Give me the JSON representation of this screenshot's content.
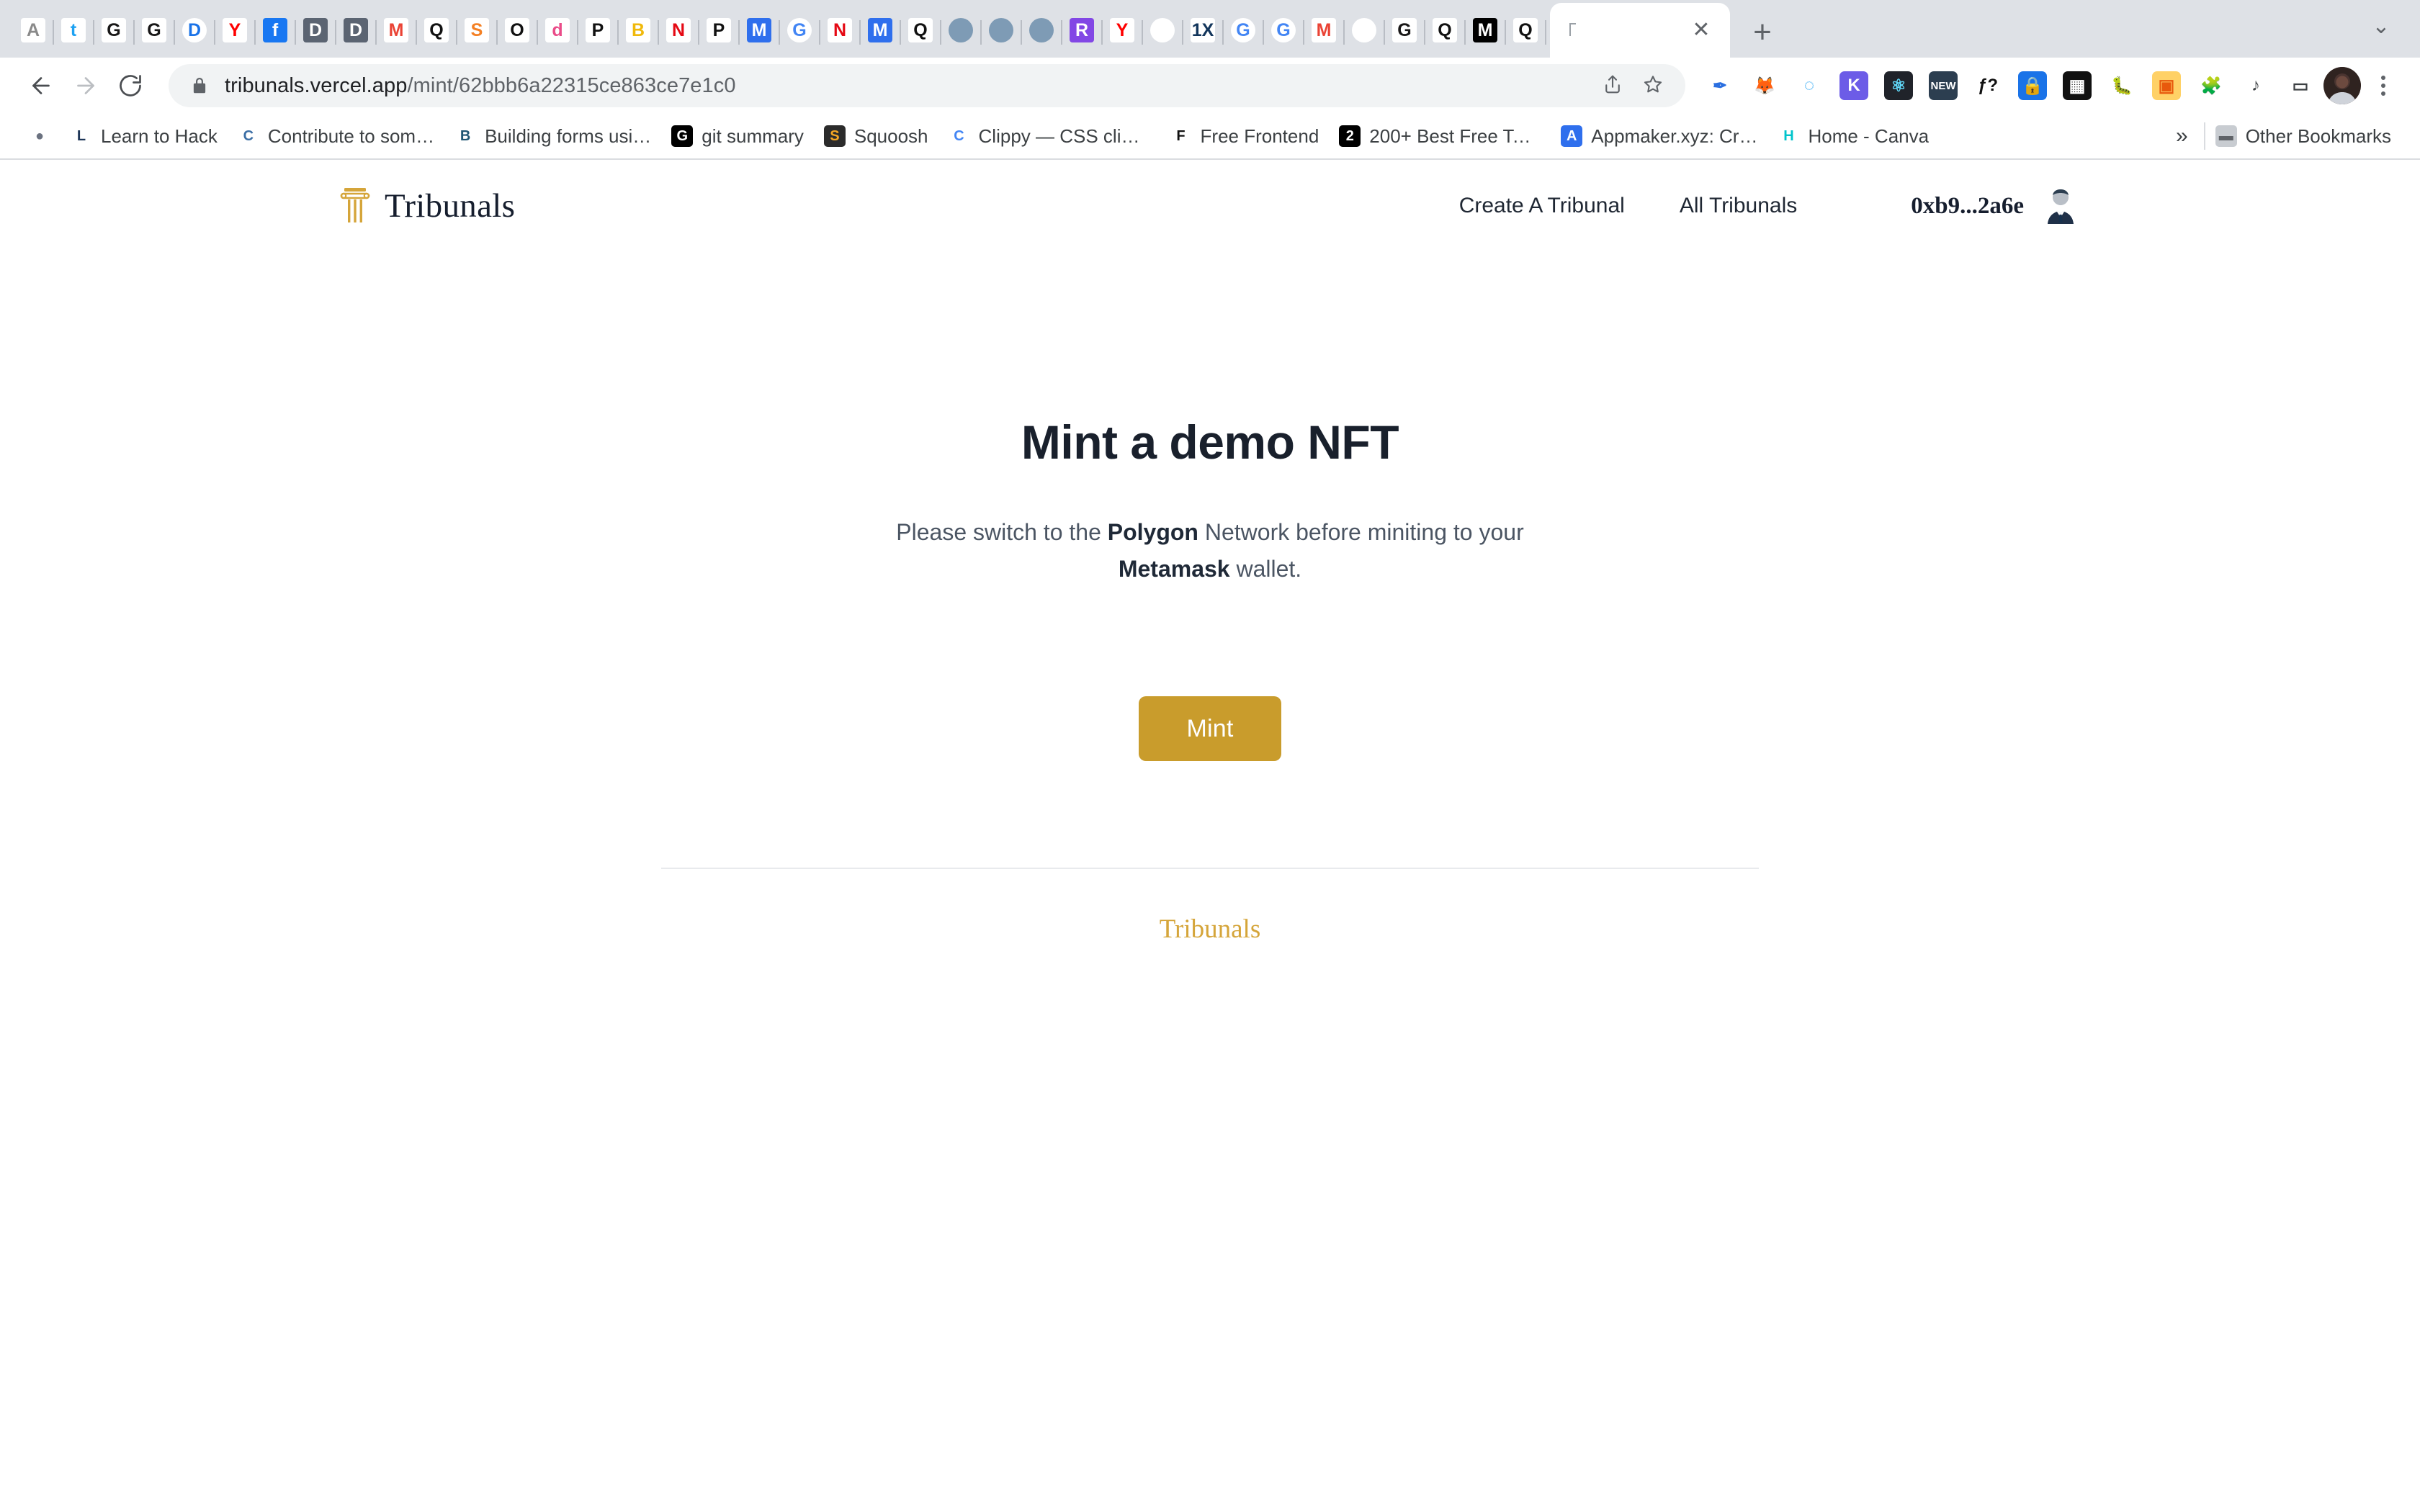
{
  "browser": {
    "tabs": [
      {
        "name": "tab-favicon-1",
        "icon": "acrobat-icon",
        "label": "A",
        "bg": "#ffffff",
        "fg": "#8a8a8a"
      },
      {
        "name": "tab-favicon-twitter",
        "icon": "twitter-icon",
        "label": "t",
        "bg": "#ffffff",
        "fg": "#1da1f2"
      },
      {
        "name": "tab-favicon-github-1",
        "icon": "github-icon",
        "label": "G",
        "bg": "#ffffff",
        "fg": "#181717"
      },
      {
        "name": "tab-favicon-github-2",
        "icon": "github-icon",
        "label": "G",
        "bg": "#ffffff",
        "fg": "#181717"
      },
      {
        "name": "tab-favicon-google-drive",
        "icon": "google-drive-icon",
        "label": "D",
        "bg": "#ffffff",
        "fg": "#1a73e8"
      },
      {
        "name": "tab-favicon-youtube-music",
        "icon": "youtube-music-icon",
        "label": "Y",
        "bg": "#ffffff",
        "fg": "#ff0000"
      },
      {
        "name": "tab-favicon-facebook",
        "icon": "facebook-icon",
        "label": "f",
        "bg": "#1877f2",
        "fg": "#ffffff"
      },
      {
        "name": "tab-favicon-device-1",
        "icon": "device-icon",
        "label": "D",
        "bg": "#5b6472",
        "fg": "#ffffff"
      },
      {
        "name": "tab-favicon-device-2",
        "icon": "device-icon",
        "label": "D",
        "bg": "#5b6472",
        "fg": "#ffffff"
      },
      {
        "name": "tab-favicon-gmail",
        "icon": "gmail-icon",
        "label": "M",
        "bg": "#ffffff",
        "fg": "#ea4335"
      },
      {
        "name": "tab-favicon-quora-1",
        "icon": "quora-icon",
        "label": "Q",
        "bg": "#ffffff",
        "fg": "#111111"
      },
      {
        "name": "tab-favicon-stackoverflow",
        "icon": "stack-overflow-icon",
        "label": "S",
        "bg": "#ffffff",
        "fg": "#f48024"
      },
      {
        "name": "tab-favicon-opensea",
        "icon": "opensea-icon",
        "label": "O",
        "bg": "#ffffff",
        "fg": "#111111"
      },
      {
        "name": "tab-favicon-dribbble",
        "icon": "dribbble-icon",
        "label": "d",
        "bg": "#ffffff",
        "fg": "#ea4c89"
      },
      {
        "name": "tab-favicon-producthunt-1",
        "icon": "producthunt-icon",
        "label": "P",
        "bg": "#ffffff",
        "fg": "#111111"
      },
      {
        "name": "tab-favicon-binance",
        "icon": "binance-icon",
        "label": "B",
        "bg": "#ffffff",
        "fg": "#f0b90b"
      },
      {
        "name": "tab-favicon-netflix-1",
        "icon": "netflix-icon",
        "label": "N",
        "bg": "#ffffff",
        "fg": "#e50914"
      },
      {
        "name": "tab-favicon-producthunt-2",
        "icon": "producthunt-icon",
        "label": "P",
        "bg": "#ffffff",
        "fg": "#111111"
      },
      {
        "name": "tab-favicon-metamask-1",
        "icon": "metamask-icon",
        "label": "M",
        "bg": "#2f6fed",
        "fg": "#ffffff"
      },
      {
        "name": "tab-favicon-google-1",
        "icon": "google-icon",
        "label": "G",
        "bg": "#ffffff",
        "fg": "#4285f4"
      },
      {
        "name": "tab-favicon-netflix-2",
        "icon": "netflix-icon",
        "label": "N",
        "bg": "#ffffff",
        "fg": "#e50914"
      },
      {
        "name": "tab-favicon-metamask-2",
        "icon": "metamask-icon",
        "label": "M",
        "bg": "#2f6fed",
        "fg": "#ffffff"
      },
      {
        "name": "tab-favicon-quora-2",
        "icon": "quora-icon",
        "label": "Q",
        "bg": "#ffffff",
        "fg": "#111111"
      },
      {
        "name": "tab-favicon-sphere-1",
        "icon": "sphere-icon",
        "label": "",
        "bg": "#7e9bb5",
        "fg": "#ffffff"
      },
      {
        "name": "tab-favicon-sphere-2",
        "icon": "sphere-icon",
        "label": "",
        "bg": "#7e9bb5",
        "fg": "#ffffff"
      },
      {
        "name": "tab-favicon-sphere-3",
        "icon": "sphere-icon",
        "label": "",
        "bg": "#7e9bb5",
        "fg": "#ffffff"
      },
      {
        "name": "tab-favicon-rarible",
        "icon": "rarible-icon",
        "label": "R",
        "bg": "#8247e5",
        "fg": "#ffffff"
      },
      {
        "name": "tab-favicon-youtube",
        "icon": "youtube-icon",
        "label": "Y",
        "bg": "#ffffff",
        "fg": "#ff0000"
      },
      {
        "name": "tab-favicon-download",
        "icon": "download-icon",
        "label": "",
        "bg": "#ffffff",
        "fg": "#8bc34a"
      },
      {
        "name": "tab-favicon-1x",
        "icon": "1x-icon",
        "label": "1X",
        "bg": "#ffffff",
        "fg": "#12355b"
      },
      {
        "name": "tab-favicon-google-2",
        "icon": "google-icon",
        "label": "G",
        "bg": "#ffffff",
        "fg": "#4285f4"
      },
      {
        "name": "tab-favicon-google-3",
        "icon": "google-icon",
        "label": "G",
        "bg": "#ffffff",
        "fg": "#4285f4"
      },
      {
        "name": "tab-favicon-gmail-2",
        "icon": "gmail-icon",
        "label": "M",
        "bg": "#ffffff",
        "fg": "#ea4335"
      },
      {
        "name": "tab-favicon-spiral",
        "icon": "spiral-icon",
        "label": "",
        "bg": "#ffffff",
        "fg": "#cf5cc0"
      },
      {
        "name": "tab-favicon-github-3",
        "icon": "github-icon",
        "label": "G",
        "bg": "#ffffff",
        "fg": "#181717"
      },
      {
        "name": "tab-favicon-quora-3",
        "icon": "quora-icon",
        "label": "Q",
        "bg": "#ffffff",
        "fg": "#111111"
      },
      {
        "name": "tab-favicon-medium",
        "icon": "medium-icon",
        "label": "M",
        "bg": "#000000",
        "fg": "#ffffff"
      },
      {
        "name": "tab-favicon-quora-4",
        "icon": "quora-icon",
        "label": "Q",
        "bg": "#ffffff",
        "fg": "#111111"
      }
    ],
    "active_tab": {
      "title": "",
      "close_label": "✕"
    },
    "new_tab_label": "+",
    "tab_list_label": "⌄",
    "toolbar": {
      "back_label": "←",
      "forward_label": "→",
      "reload_label": "↻",
      "url_domain": "tribunals.vercel.app",
      "url_path": "/mint/62bbb6a22315ce863ce7e1c0",
      "share_label": "⇧",
      "bookmark_star_label": "☆",
      "extensions": [
        {
          "name": "eyedropper-extension-icon",
          "label": "✒",
          "bg": "#ffffff",
          "fg": "#2b6fe0"
        },
        {
          "name": "metamask-extension-icon",
          "label": "🦊",
          "bg": "#ffffff",
          "fg": "#e2761b"
        },
        {
          "name": "spiral-extension-icon",
          "label": "◌",
          "bg": "#ffffff",
          "fg": "#1da0f2"
        },
        {
          "name": "kite-extension-icon",
          "label": "K",
          "bg": "#6c5ce7",
          "fg": "#ffffff"
        },
        {
          "name": "react-devtools-extension-icon",
          "label": "⚛",
          "bg": "#20232a",
          "fg": "#61dafb"
        },
        {
          "name": "new-badge-extension-icon",
          "label": "NEW",
          "bg": "#2c3e50",
          "fg": "#ffffff"
        },
        {
          "name": "fonts-ninja-extension-icon",
          "label": "ƒ?",
          "bg": "#ffffff",
          "fg": "#111111"
        },
        {
          "name": "lastpass-extension-icon",
          "label": "🔒",
          "bg": "#1a73e8",
          "fg": "#ffffff"
        },
        {
          "name": "checker-extension-icon",
          "label": "▦",
          "bg": "#111111",
          "fg": "#ffffff"
        },
        {
          "name": "debug-bug-extension-icon",
          "label": "🐛",
          "bg": "#ffffff",
          "fg": "#888888"
        },
        {
          "name": "chip-extension-icon",
          "label": "▣",
          "bg": "#ffd166",
          "fg": "#e8590c"
        },
        {
          "name": "puzzle-extensions-icon",
          "label": "🧩",
          "bg": "#ffffff",
          "fg": "#5f6368"
        },
        {
          "name": "reading-list-extension-icon",
          "label": "♪",
          "bg": "#ffffff",
          "fg": "#3c4043"
        },
        {
          "name": "side-panel-icon",
          "label": "▭",
          "bg": "#ffffff",
          "fg": "#3c4043"
        }
      ],
      "profile_avatar_label": "",
      "menu_label": "⋮"
    },
    "bookmarks": {
      "items": [
        {
          "name": "bookmark-globe",
          "label": "",
          "icon": "globe-icon",
          "bg": "#ffffff",
          "fg": "#6b7280"
        },
        {
          "name": "bookmark-learn-to-hack",
          "label": "Learn to Hack",
          "icon": "ha-icon",
          "bg": "#ffffff",
          "fg": "#1d3557"
        },
        {
          "name": "bookmark-contribute",
          "label": "Contribute to som…",
          "icon": "person-icon",
          "bg": "#ffffff",
          "fg": "#3b6ea5"
        },
        {
          "name": "bookmark-building-forms",
          "label": "Building forms usi…",
          "icon": "article-icon",
          "bg": "#ffffff",
          "fg": "#1f5673"
        },
        {
          "name": "bookmark-git-summary",
          "label": "git summary",
          "icon": "medium-icon",
          "bg": "#000000",
          "fg": "#ffffff"
        },
        {
          "name": "bookmark-squoosh",
          "label": "Squoosh",
          "icon": "squoosh-icon",
          "bg": "#2b2b2b",
          "fg": "#f5a623"
        },
        {
          "name": "bookmark-clippy",
          "label": "Clippy — CSS clip…",
          "icon": "clippy-icon",
          "bg": "#ffffff",
          "fg": "#4285f4"
        },
        {
          "name": "bookmark-free-frontend",
          "label": "Free Frontend",
          "icon": "f-icon",
          "bg": "#ffffff",
          "fg": "#111111"
        },
        {
          "name": "bookmark-best-free-tools",
          "label": "200+ Best Free To…",
          "icon": "medium-icon",
          "bg": "#000000",
          "fg": "#ffffff"
        },
        {
          "name": "bookmark-appmaker",
          "label": "Appmaker.xyz: Cr…",
          "icon": "appmaker-icon",
          "bg": "#2f6fed",
          "fg": "#ffffff"
        },
        {
          "name": "bookmark-home-canva",
          "label": "Home - Canva",
          "icon": "canva-icon",
          "bg": "#ffffff",
          "fg": "#00c4cc"
        }
      ],
      "overflow_label": "»",
      "other_bookmarks_label": "Other Bookmarks",
      "other_bookmarks_icon": "folder-icon"
    }
  },
  "site": {
    "brand": {
      "name": "Tribunals",
      "logo_icon": "pillar-icon",
      "logo_color": "#d5a53a"
    },
    "nav": {
      "links": [
        {
          "name": "nav-create-a-tribunal",
          "label": "Create A Tribunal"
        },
        {
          "name": "nav-all-tribunals",
          "label": "All Tribunals"
        }
      ],
      "wallet_address": "0xb9...2a6e",
      "avatar_icon": "user-avatar-icon"
    },
    "main": {
      "heading": "Mint a demo NFT",
      "lead_part1": "Please switch to the ",
      "lead_bold1": "Polygon",
      "lead_part2": " Network before miniting to your ",
      "lead_bold2": "Metamask",
      "lead_part3": " wallet.",
      "mint_button_label": "Mint",
      "mint_button_color": "#c99c2c"
    },
    "footer": {
      "brand_label": "Tribunals",
      "brand_color": "#d5a53a"
    }
  }
}
